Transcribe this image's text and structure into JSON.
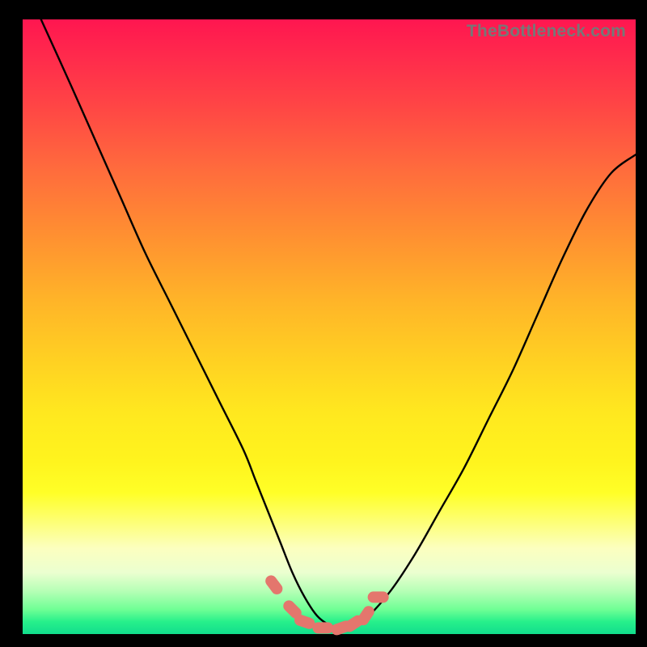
{
  "watermark": "TheBottleneck.com",
  "chart_data": {
    "type": "line",
    "title": "",
    "xlabel": "",
    "ylabel": "",
    "xlim": [
      0,
      100
    ],
    "ylim": [
      0,
      100
    ],
    "series": [
      {
        "name": "curve",
        "x": [
          3,
          8,
          12,
          16,
          20,
          24,
          28,
          32,
          36,
          38,
          40,
          42,
          44,
          46,
          48,
          50,
          52,
          54,
          56,
          60,
          64,
          68,
          72,
          76,
          80,
          84,
          88,
          92,
          96,
          100
        ],
        "y": [
          100,
          89,
          80,
          71,
          62,
          54,
          46,
          38,
          30,
          25,
          20,
          15,
          10,
          6,
          3,
          1.5,
          1,
          1.2,
          2.5,
          7,
          13,
          20,
          27,
          35,
          43,
          52,
          61,
          69,
          75,
          78
        ]
      }
    ],
    "markers": {
      "name": "markers",
      "x": [
        41,
        44,
        46,
        49,
        52,
        54,
        56,
        58
      ],
      "y": [
        8,
        4,
        2,
        1,
        1,
        1.7,
        3,
        6
      ]
    },
    "marker_color": "#e4766d",
    "curve_color": "#000000"
  }
}
